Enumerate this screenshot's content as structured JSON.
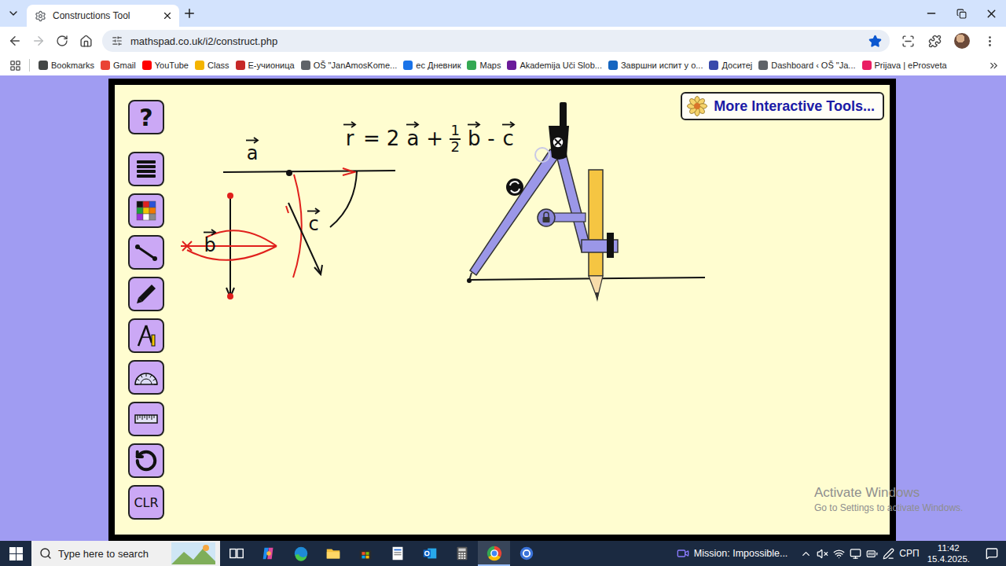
{
  "browser": {
    "tabs": [
      {
        "label": "Constructions Tool",
        "selected": true
      }
    ],
    "nav": {
      "back_enabled": true,
      "forward_enabled": false
    },
    "url": "mathspad.co.uk/i2/construct.php",
    "bookmarked": true,
    "bookmarks": [
      {
        "label": "Bookmarks",
        "color": "#444746"
      },
      {
        "label": "Gmail",
        "color": "#ea4335"
      },
      {
        "label": "YouTube",
        "color": "#ff0000"
      },
      {
        "label": "Class",
        "color": "#f4b400"
      },
      {
        "label": "Е-учионица",
        "color": "#c62828"
      },
      {
        "label": "OŠ \"JanAmosKome...",
        "color": "#5f6368"
      },
      {
        "label": "ес Дневник",
        "color": "#1a73e8"
      },
      {
        "label": "Maps",
        "color": "#34a853"
      },
      {
        "label": "Akademija Uči Slob...",
        "color": "#6a1b9a"
      },
      {
        "label": "Завршни испит у о...",
        "color": "#1565c0"
      },
      {
        "label": "Доситеј",
        "color": "#3949ab"
      },
      {
        "label": "Dashboard ‹ OŠ \"Ja...",
        "color": "#5f6368"
      },
      {
        "label": "Prijava | eProsveta",
        "color": "#e91e63"
      }
    ]
  },
  "page": {
    "more_tools": "More Interactive Tools...",
    "tools": [
      {
        "kind": "help",
        "label": "?"
      },
      {
        "kind": "lines"
      },
      {
        "kind": "colors"
      },
      {
        "kind": "segment"
      },
      {
        "kind": "pencil"
      },
      {
        "kind": "compass"
      },
      {
        "kind": "protractor"
      },
      {
        "kind": "ruler"
      },
      {
        "kind": "undo"
      },
      {
        "kind": "clear",
        "label": "CLR"
      }
    ],
    "vector_labels": [
      "a",
      "b",
      "c"
    ],
    "equation": [
      {
        "kind": "vector",
        "text": "r"
      },
      {
        "kind": "symbol",
        "text": "="
      },
      {
        "kind": "symbol",
        "text": "2"
      },
      {
        "kind": "vector",
        "text": "a"
      },
      {
        "kind": "symbol",
        "text": "+"
      },
      {
        "kind": "fraction",
        "num": "1",
        "den": "2"
      },
      {
        "kind": "vector",
        "text": "b"
      },
      {
        "kind": "symbol",
        "text": "-"
      },
      {
        "kind": "vector",
        "text": "c"
      }
    ]
  },
  "watermark": {
    "title": "Activate Windows",
    "subtitle": "Go to Settings to activate Windows."
  },
  "taskbar": {
    "search_placeholder": "Type here to search",
    "apps": [
      {
        "kind": "taskview",
        "selected": false
      },
      {
        "kind": "copilot",
        "selected": false
      },
      {
        "kind": "edge",
        "selected": false
      },
      {
        "kind": "explorer",
        "selected": false
      },
      {
        "kind": "store",
        "selected": false
      },
      {
        "kind": "notepad",
        "selected": false
      },
      {
        "kind": "outlook",
        "selected": false
      },
      {
        "kind": "calculator",
        "selected": false
      },
      {
        "kind": "chrome",
        "selected": true
      },
      {
        "kind": "app",
        "selected": false
      }
    ],
    "media": "Mission: Impossible...",
    "muted": true,
    "language": "СРП",
    "time": "11:42",
    "date": "15.4.2025."
  }
}
